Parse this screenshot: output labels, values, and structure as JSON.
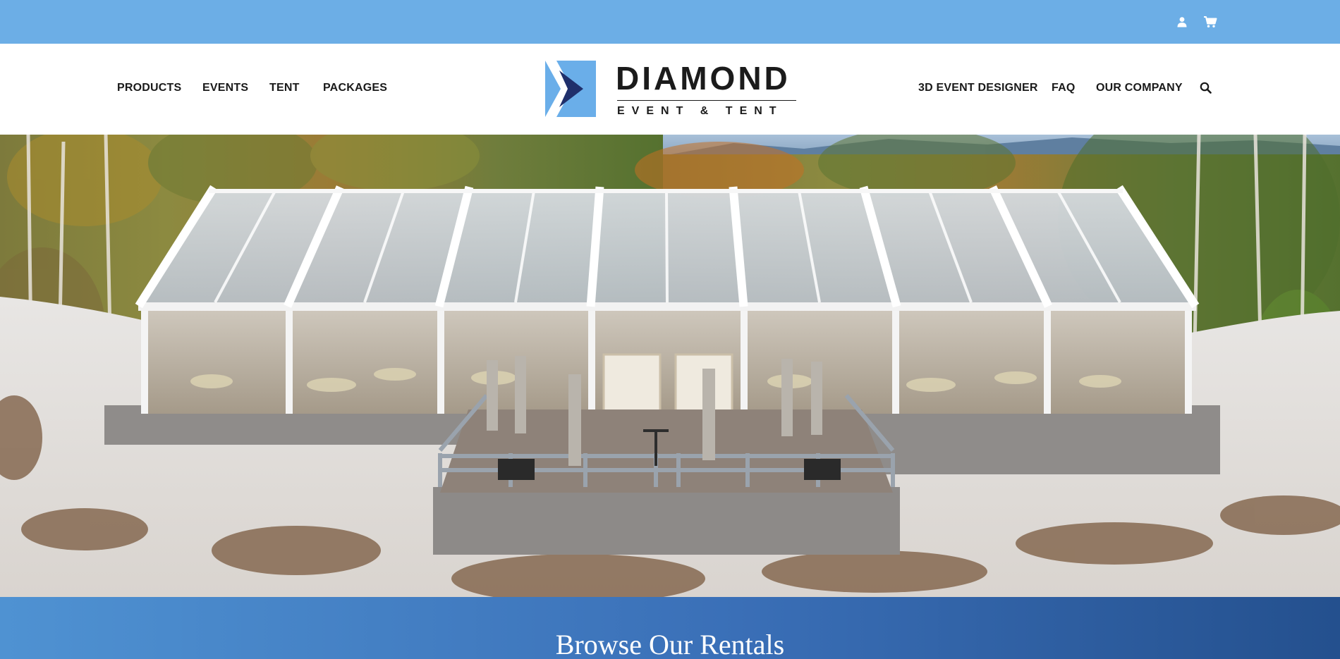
{
  "nav_left": [
    "PRODUCTS",
    "EVENTS",
    "TENT",
    "PACKAGES"
  ],
  "nav_right": [
    "3D EVENT DESIGNER",
    "FAQ",
    "OUR COMPANY"
  ],
  "logo": {
    "title": "DIAMOND",
    "subtitle": "EVENT & TENT"
  },
  "icons": {
    "account": "user-icon",
    "cart": "shopping-cart-icon",
    "search": "search-icon"
  },
  "banner": {
    "title": "Browse Our Rentals"
  },
  "colors": {
    "topbar": "#6caee6",
    "brand_blue": "#6aaee9",
    "brand_dark": "#1f2f6b",
    "banner_start": "#4f92d2",
    "banner_end": "#24508e"
  }
}
